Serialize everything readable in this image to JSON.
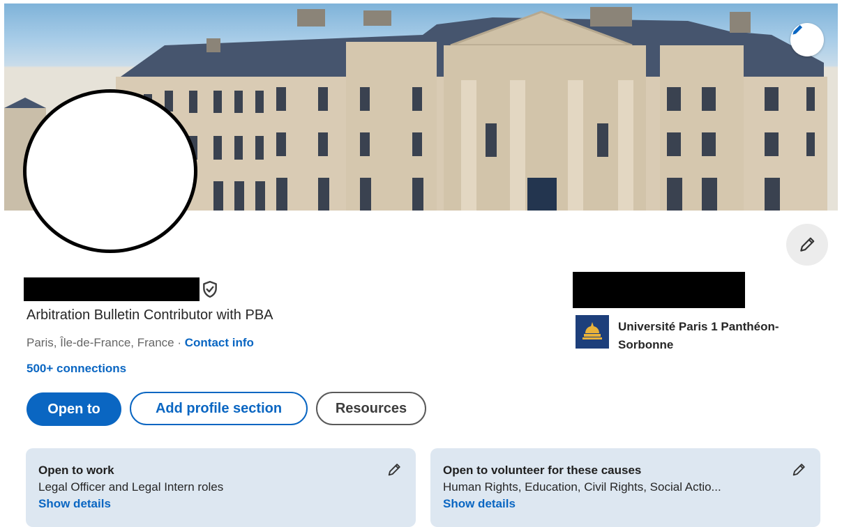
{
  "profile": {
    "headline": "Arbitration Bulletin Contributor with PBA",
    "location": "Paris, Île-de-France, France · ",
    "contact_info": "Contact info",
    "connections": "500+ connections"
  },
  "actions": {
    "open_to": "Open to",
    "add_profile_section": "Add profile section",
    "resources": "Resources"
  },
  "education": {
    "name": "Université Paris 1 Panthéon-Sorbonne"
  },
  "cards": [
    {
      "title": "Open to work",
      "subtitle": "Legal Officer and Legal Intern roles",
      "link": "Show details"
    },
    {
      "title": "Open to volunteer for these causes",
      "subtitle": "Human Rights, Education, Civil Rights, Social Actio...",
      "link": "Show details"
    }
  ],
  "icons": {
    "cover_edit": "pencil-icon",
    "profile_edit": "pencil-icon",
    "verified": "shield-check-icon",
    "card_edit": "pencil-icon"
  },
  "colors": {
    "accent": "#0a66c2",
    "card_bg": "#dde7f1",
    "university_logo": "#1d3f7b"
  }
}
